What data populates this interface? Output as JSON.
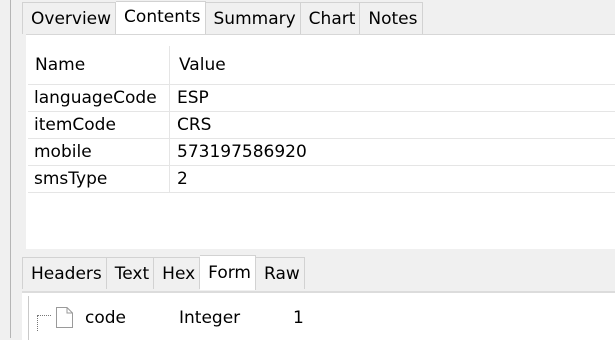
{
  "top_tabs": [
    "Overview",
    "Contents",
    "Summary",
    "Chart",
    "Notes"
  ],
  "top_active": "Contents",
  "table": {
    "headers": [
      "Name",
      "Value"
    ],
    "rows": [
      [
        "languageCode",
        "ESP"
      ],
      [
        "itemCode",
        "CRS"
      ],
      [
        "mobile",
        "573197586920"
      ],
      [
        "smsType",
        "2"
      ]
    ]
  },
  "bottom_tabs": [
    "Headers",
    "Text",
    "Hex",
    "Form",
    "Raw"
  ],
  "bottom_active": "Form",
  "form_tree": [
    {
      "name": "code",
      "type": "Integer",
      "value": "1"
    }
  ]
}
